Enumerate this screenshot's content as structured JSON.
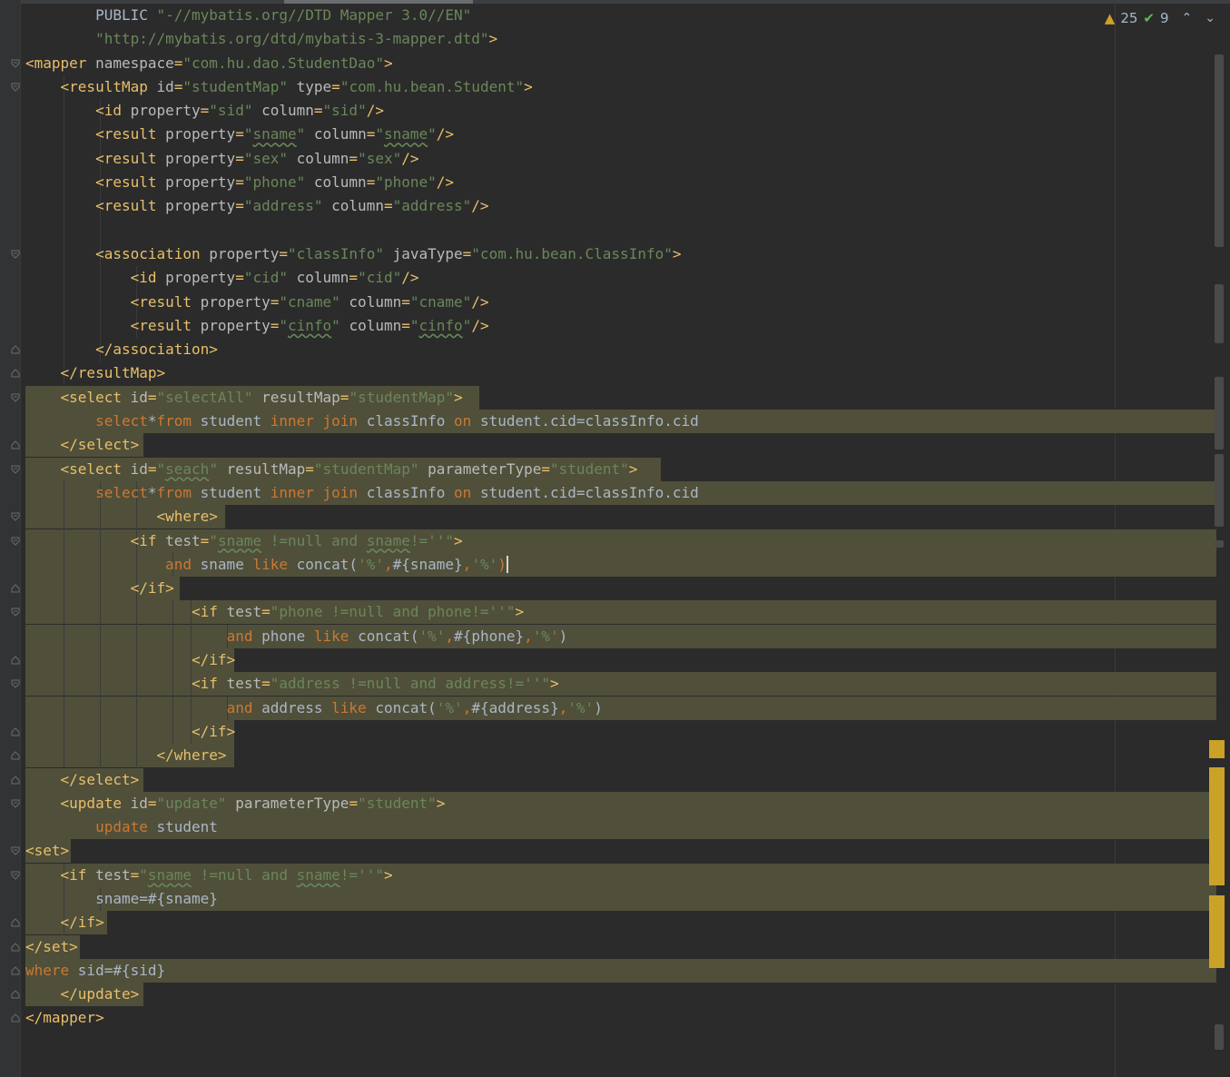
{
  "inspections": {
    "warning_count": "25",
    "ok_count": "9",
    "nav_up": "⌃",
    "nav_down": "⌄",
    "warning_icon": "warning-triangle-icon",
    "ok_icon": "double-check-icon"
  },
  "colors": {
    "tag": "#e8bf6a",
    "attribute": "#bababa",
    "value": "#6a8759",
    "keyword": "#cc7832",
    "text": "#a9b7c6",
    "highlight": "#504f3a",
    "background": "#2b2b2b",
    "marker": "#c9a227"
  },
  "code": {
    "lines": [
      [
        [
          "plain",
          "        PUBLIC "
        ],
        [
          "val",
          "\"-//mybatis.org//DTD Mapper 3.0//EN\""
        ]
      ],
      [
        [
          "val",
          "        \"http://mybatis.org/dtd/mybatis-3-mapper.dtd\""
        ],
        [
          "tag",
          ">"
        ]
      ],
      [
        [
          "tag",
          "<mapper "
        ],
        [
          "attr",
          "namespace"
        ],
        [
          "tag",
          "="
        ],
        [
          "val",
          "\"com.hu.dao.StudentDao\""
        ],
        [
          "tag",
          ">"
        ]
      ],
      [
        [
          "plain",
          "    "
        ],
        [
          "tag",
          "<resultMap "
        ],
        [
          "attr",
          "id"
        ],
        [
          "tag",
          "="
        ],
        [
          "val",
          "\"studentMap\" "
        ],
        [
          "attr",
          "type"
        ],
        [
          "tag",
          "="
        ],
        [
          "val",
          "\"com.hu.bean.Student\""
        ],
        [
          "tag",
          ">"
        ]
      ],
      [
        [
          "plain",
          "        "
        ],
        [
          "tag",
          "<id "
        ],
        [
          "attr",
          "property"
        ],
        [
          "tag",
          "="
        ],
        [
          "val",
          "\"sid\" "
        ],
        [
          "attr",
          "column"
        ],
        [
          "tag",
          "="
        ],
        [
          "val",
          "\"sid\""
        ],
        [
          "tag",
          "/>"
        ]
      ],
      [
        [
          "plain",
          "        "
        ],
        [
          "tag",
          "<result "
        ],
        [
          "attr",
          "property"
        ],
        [
          "tag",
          "="
        ],
        [
          "val",
          "\""
        ],
        [
          "valu",
          "sname"
        ],
        [
          "val",
          "\" "
        ],
        [
          "attr",
          "column"
        ],
        [
          "tag",
          "="
        ],
        [
          "val",
          "\""
        ],
        [
          "valu",
          "sname"
        ],
        [
          "val",
          "\""
        ],
        [
          "tag",
          "/>"
        ]
      ],
      [
        [
          "plain",
          "        "
        ],
        [
          "tag",
          "<result "
        ],
        [
          "attr",
          "property"
        ],
        [
          "tag",
          "="
        ],
        [
          "val",
          "\"sex\" "
        ],
        [
          "attr",
          "column"
        ],
        [
          "tag",
          "="
        ],
        [
          "val",
          "\"sex\""
        ],
        [
          "tag",
          "/>"
        ]
      ],
      [
        [
          "plain",
          "        "
        ],
        [
          "tag",
          "<result "
        ],
        [
          "attr",
          "property"
        ],
        [
          "tag",
          "="
        ],
        [
          "val",
          "\"phone\" "
        ],
        [
          "attr",
          "column"
        ],
        [
          "tag",
          "="
        ],
        [
          "val",
          "\"phone\""
        ],
        [
          "tag",
          "/>"
        ]
      ],
      [
        [
          "plain",
          "        "
        ],
        [
          "tag",
          "<result "
        ],
        [
          "attr",
          "property"
        ],
        [
          "tag",
          "="
        ],
        [
          "val",
          "\"address\" "
        ],
        [
          "attr",
          "column"
        ],
        [
          "tag",
          "="
        ],
        [
          "val",
          "\"address\""
        ],
        [
          "tag",
          "/>"
        ]
      ],
      [],
      [
        [
          "plain",
          "        "
        ],
        [
          "tag",
          "<association "
        ],
        [
          "attr",
          "property"
        ],
        [
          "tag",
          "="
        ],
        [
          "val",
          "\"classInfo\" "
        ],
        [
          "attr",
          "javaType"
        ],
        [
          "tag",
          "="
        ],
        [
          "val",
          "\"com.hu.bean.ClassInfo\""
        ],
        [
          "tag",
          ">"
        ]
      ],
      [
        [
          "plain",
          "            "
        ],
        [
          "tag",
          "<id "
        ],
        [
          "attr",
          "property"
        ],
        [
          "tag",
          "="
        ],
        [
          "val",
          "\"cid\" "
        ],
        [
          "attr",
          "column"
        ],
        [
          "tag",
          "="
        ],
        [
          "val",
          "\"cid\""
        ],
        [
          "tag",
          "/>"
        ]
      ],
      [
        [
          "plain",
          "            "
        ],
        [
          "tag",
          "<result "
        ],
        [
          "attr",
          "property"
        ],
        [
          "tag",
          "="
        ],
        [
          "val",
          "\"cname\" "
        ],
        [
          "attr",
          "column"
        ],
        [
          "tag",
          "="
        ],
        [
          "val",
          "\"cname\""
        ],
        [
          "tag",
          "/>"
        ]
      ],
      [
        [
          "plain",
          "            "
        ],
        [
          "tag",
          "<result "
        ],
        [
          "attr",
          "property"
        ],
        [
          "tag",
          "="
        ],
        [
          "val",
          "\""
        ],
        [
          "valu",
          "cinfo"
        ],
        [
          "val",
          "\" "
        ],
        [
          "attr",
          "column"
        ],
        [
          "tag",
          "="
        ],
        [
          "val",
          "\""
        ],
        [
          "valu",
          "cinfo"
        ],
        [
          "val",
          "\""
        ],
        [
          "tag",
          "/>"
        ]
      ],
      [
        [
          "plain",
          "        "
        ],
        [
          "tag",
          "</association>"
        ]
      ],
      [
        [
          "plain",
          "    "
        ],
        [
          "tag",
          "</resultMap>"
        ]
      ],
      [
        [
          "plain",
          "    "
        ],
        [
          "tag",
          "<select "
        ],
        [
          "attr",
          "id"
        ],
        [
          "tag",
          "="
        ],
        [
          "val",
          "\"selectAll\" "
        ],
        [
          "attr",
          "resultMap"
        ],
        [
          "tag",
          "="
        ],
        [
          "val",
          "\"studentMap\""
        ],
        [
          "tag",
          ">"
        ]
      ],
      [
        [
          "plain",
          "        "
        ],
        [
          "kw",
          "select"
        ],
        [
          "plain",
          "*"
        ],
        [
          "kw",
          "from "
        ],
        [
          "plain",
          "student "
        ],
        [
          "kw",
          "inner join "
        ],
        [
          "plain",
          "classInfo "
        ],
        [
          "kw",
          "on "
        ],
        [
          "plain",
          "student.cid=classInfo.cid"
        ]
      ],
      [
        [
          "plain",
          "    "
        ],
        [
          "tag",
          "</select>"
        ]
      ],
      [
        [
          "plain",
          "    "
        ],
        [
          "tag",
          "<select "
        ],
        [
          "attr",
          "id"
        ],
        [
          "tag",
          "="
        ],
        [
          "val",
          "\""
        ],
        [
          "valu",
          "seach"
        ],
        [
          "val",
          "\" "
        ],
        [
          "attr",
          "resultMap"
        ],
        [
          "tag",
          "="
        ],
        [
          "val",
          "\"studentMap\" "
        ],
        [
          "attr",
          "parameterType"
        ],
        [
          "tag",
          "="
        ],
        [
          "val",
          "\"student\""
        ],
        [
          "tag",
          ">"
        ]
      ],
      [
        [
          "plain",
          "        "
        ],
        [
          "kw",
          "select"
        ],
        [
          "plain",
          "*"
        ],
        [
          "kw",
          "from "
        ],
        [
          "plain",
          "student "
        ],
        [
          "kw",
          "inner join "
        ],
        [
          "plain",
          "classInfo "
        ],
        [
          "kw",
          "on "
        ],
        [
          "plain",
          "student.cid=classInfo.cid"
        ]
      ],
      [
        [
          "plain",
          "               "
        ],
        [
          "tag",
          "<where>"
        ]
      ],
      [
        [
          "plain",
          "            "
        ],
        [
          "tag",
          "<if "
        ],
        [
          "attr",
          "test"
        ],
        [
          "tag",
          "="
        ],
        [
          "val",
          "\""
        ],
        [
          "valu",
          "sname"
        ],
        [
          "val",
          " !=null and "
        ],
        [
          "valu",
          "sname"
        ],
        [
          "val",
          "!=''\""
        ],
        [
          "tag",
          ">"
        ]
      ],
      [
        [
          "plain",
          "                "
        ],
        [
          "kw",
          "and "
        ],
        [
          "plain",
          "sname "
        ],
        [
          "kw",
          "like "
        ],
        [
          "plain",
          "concat("
        ],
        [
          "val",
          "'%'"
        ],
        [
          "kw",
          ","
        ],
        [
          "plain",
          "#{sname}"
        ],
        [
          "kw",
          ","
        ],
        [
          "val",
          "'%'"
        ],
        [
          "caret",
          ")"
        ]
      ],
      [
        [
          "plain",
          "            "
        ],
        [
          "tag",
          "</if>"
        ]
      ],
      [
        [
          "plain",
          "                   "
        ],
        [
          "tag",
          "<if "
        ],
        [
          "attr",
          "test"
        ],
        [
          "tag",
          "="
        ],
        [
          "val",
          "\"phone !=null and phone!=''\""
        ],
        [
          "tag",
          ">"
        ]
      ],
      [
        [
          "plain",
          "                       "
        ],
        [
          "kw",
          "and "
        ],
        [
          "plain",
          "phone "
        ],
        [
          "kw",
          "like "
        ],
        [
          "plain",
          "concat("
        ],
        [
          "val",
          "'%'"
        ],
        [
          "kw",
          ","
        ],
        [
          "plain",
          "#{phone}"
        ],
        [
          "kw",
          ","
        ],
        [
          "val",
          "'%'"
        ],
        [
          "plain",
          ")"
        ]
      ],
      [
        [
          "plain",
          "                   "
        ],
        [
          "tag",
          "</if>"
        ]
      ],
      [
        [
          "plain",
          "                   "
        ],
        [
          "tag",
          "<if "
        ],
        [
          "attr",
          "test"
        ],
        [
          "tag",
          "="
        ],
        [
          "val",
          "\"address !=null and address!=''\""
        ],
        [
          "tag",
          ">"
        ]
      ],
      [
        [
          "plain",
          "                       "
        ],
        [
          "kw",
          "and "
        ],
        [
          "plain",
          "address "
        ],
        [
          "kw",
          "like "
        ],
        [
          "plain",
          "concat("
        ],
        [
          "val",
          "'%'"
        ],
        [
          "kw",
          ","
        ],
        [
          "plain",
          "#{address}"
        ],
        [
          "kw",
          ","
        ],
        [
          "val",
          "'%'"
        ],
        [
          "plain",
          ")"
        ]
      ],
      [
        [
          "plain",
          "                   "
        ],
        [
          "tag",
          "</if>"
        ]
      ],
      [
        [
          "plain",
          "               "
        ],
        [
          "tag",
          "</where>"
        ]
      ],
      [
        [
          "plain",
          "    "
        ],
        [
          "tag",
          "</select>"
        ]
      ],
      [
        [
          "plain",
          "    "
        ],
        [
          "tag",
          "<update "
        ],
        [
          "attr",
          "id"
        ],
        [
          "tag",
          "="
        ],
        [
          "val",
          "\"update\" "
        ],
        [
          "attr",
          "parameterType"
        ],
        [
          "tag",
          "="
        ],
        [
          "val",
          "\"student\""
        ],
        [
          "tag",
          ">"
        ]
      ],
      [
        [
          "plain",
          "        "
        ],
        [
          "kw",
          "update "
        ],
        [
          "plain",
          "student"
        ]
      ],
      [
        [
          "tag",
          "<set>"
        ]
      ],
      [
        [
          "plain",
          "    "
        ],
        [
          "tag",
          "<if "
        ],
        [
          "attr",
          "test"
        ],
        [
          "tag",
          "="
        ],
        [
          "val",
          "\""
        ],
        [
          "valu",
          "sname"
        ],
        [
          "val",
          " !=null and "
        ],
        [
          "valu",
          "sname"
        ],
        [
          "val",
          "!=''\""
        ],
        [
          "tag",
          ">"
        ]
      ],
      [
        [
          "plain",
          "        sname=#{sname}"
        ]
      ],
      [
        [
          "plain",
          "    "
        ],
        [
          "tag",
          "</if>"
        ]
      ],
      [
        [
          "tag",
          "</set>"
        ]
      ],
      [
        [
          "kw",
          "where "
        ],
        [
          "plain",
          "sid=#{sid}"
        ]
      ],
      [
        [
          "plain",
          "    "
        ],
        [
          "tag",
          "</update>"
        ]
      ],
      [
        [
          "tag",
          "</mapper>"
        ]
      ]
    ]
  }
}
